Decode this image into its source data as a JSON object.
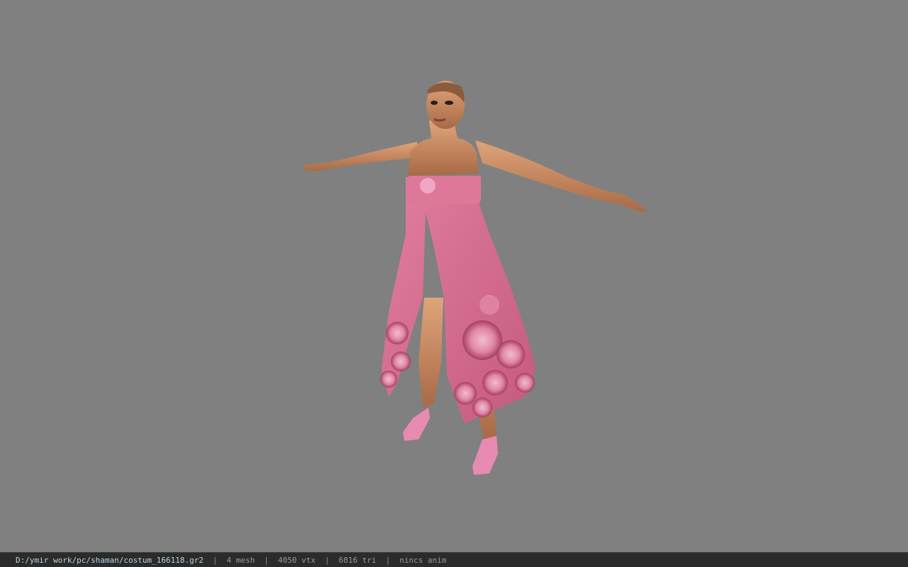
{
  "viewer": {
    "background_color": "#808080",
    "model_description": "character-model-pink-dress"
  },
  "status_bar": {
    "file_path": "D:/ymir work/pc/shaman/costum_166118.gr2",
    "mesh_count": "4 mesh",
    "vertex_count": "4050 vtx",
    "triangle_count": "6816 tri",
    "anim_status": "nincs anim",
    "separator": "|"
  },
  "colors": {
    "dress": "#d9708f",
    "skin": "#c98a5f",
    "shoes": "#e88bb2",
    "status_bg": "#2b2b2b",
    "path_text": "#b9d4e4"
  }
}
